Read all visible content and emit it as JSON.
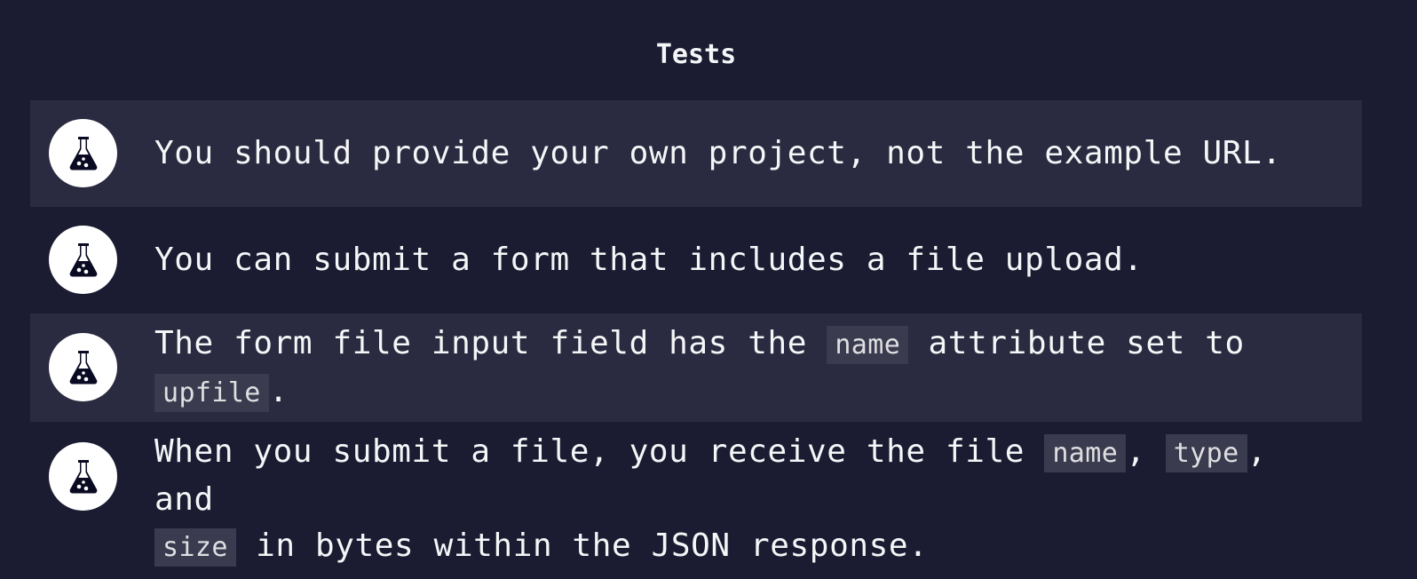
{
  "header": {
    "title": "Tests"
  },
  "tests": [
    {
      "icon": "flask-icon",
      "parts": [
        {
          "text": "You should provide your own project, not the example URL."
        }
      ]
    },
    {
      "icon": "flask-icon",
      "parts": [
        {
          "text": "You can submit a form that includes a file upload."
        }
      ]
    },
    {
      "icon": "flask-icon",
      "parts": [
        {
          "text": "The form file input field has the "
        },
        {
          "code": "name"
        },
        {
          "text": " attribute set to "
        },
        {
          "code": "upfile"
        },
        {
          "text": "."
        }
      ]
    },
    {
      "icon": "flask-icon",
      "parts": [
        {
          "text": "When you submit a file, you receive the file "
        },
        {
          "code": "name"
        },
        {
          "text": ", "
        },
        {
          "code": "type"
        },
        {
          "text": ", and "
        },
        {
          "code": "size"
        },
        {
          "text": " in bytes within the JSON response."
        }
      ]
    }
  ],
  "colors": {
    "background": "#1b1b32",
    "row_shaded": "#2a2a40",
    "text": "#f5f6f7",
    "code_background": "#3b3b4f",
    "icon_circle": "#ffffff",
    "icon_glyph": "#0a0a23"
  }
}
